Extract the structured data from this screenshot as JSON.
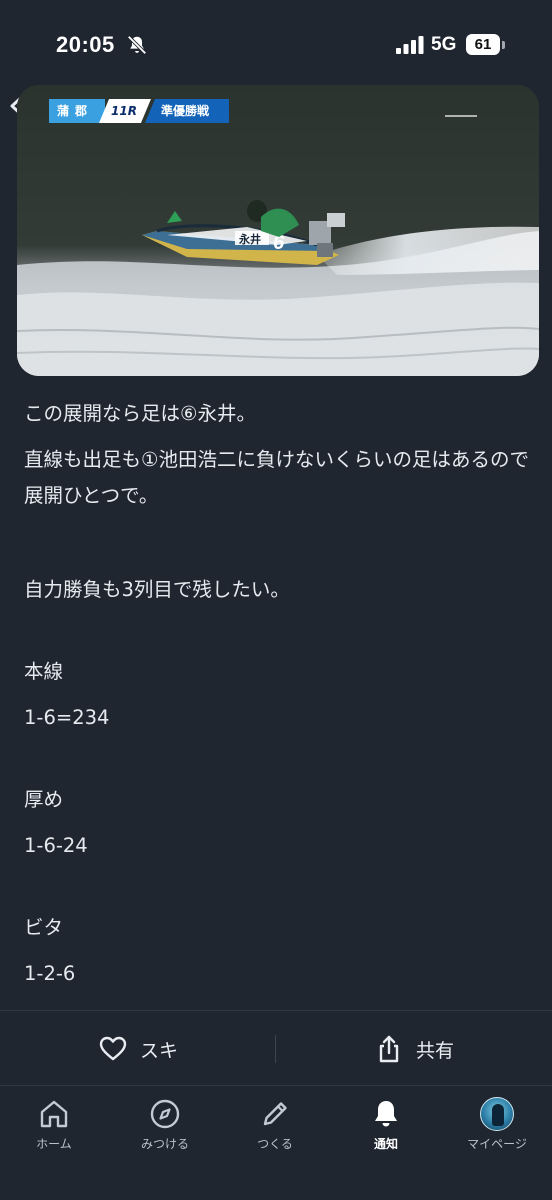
{
  "status_bar": {
    "time": "20:05",
    "network": "5G",
    "battery": "61",
    "silent_icon": "bell-slash-icon",
    "signal_icon": "cellular-signal-icon"
  },
  "nav": {
    "back_icon": "chevron-left-icon"
  },
  "video": {
    "venue": "蒲郡",
    "race": "11R",
    "title": "準優勝戦",
    "boat_name": "永井",
    "boat_number": "6"
  },
  "article": {
    "lines": [
      "この展開なら足は⑥永井。",
      "直線も出足も①池田浩二に負けないくらいの足はあるので展開ひとつで。",
      "自力勝負も3列目で残したい。",
      "本線",
      "1-6=234",
      "厚め",
      "1-6-24",
      "ビタ",
      "1-2-6"
    ]
  },
  "actions": {
    "like_label": "スキ",
    "like_icon": "heart-icon",
    "share_label": "共有",
    "share_icon": "share-icon"
  },
  "tabs": [
    {
      "label": "ホーム",
      "icon": "home-icon",
      "active": false
    },
    {
      "label": "みつける",
      "icon": "compass-icon",
      "active": false
    },
    {
      "label": "つくる",
      "icon": "pencil-icon",
      "active": false
    },
    {
      "label": "通知",
      "icon": "bell-icon",
      "active": true
    },
    {
      "label": "マイページ",
      "icon": "avatar",
      "active": false
    }
  ],
  "colors": {
    "background": "#1f2630",
    "text": "#e6eaef",
    "accent_blue": "#1364b8"
  }
}
